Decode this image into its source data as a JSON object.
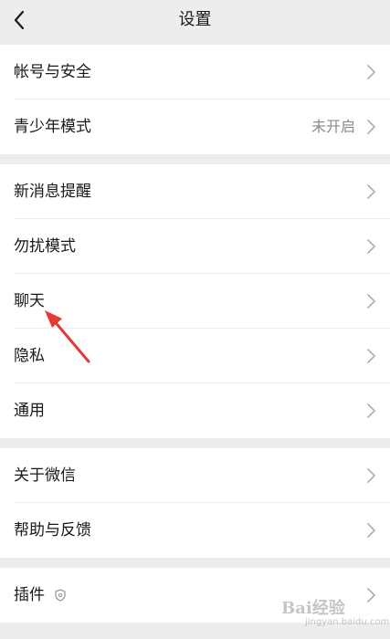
{
  "header": {
    "title": "设置",
    "back_icon": "chevron-left-icon"
  },
  "group1": {
    "items": [
      {
        "label": "帐号与安全",
        "value": ""
      },
      {
        "label": "青少年模式",
        "value": "未开启"
      }
    ]
  },
  "group2": {
    "items": [
      {
        "label": "新消息提醒"
      },
      {
        "label": "勿扰模式"
      },
      {
        "label": "聊天"
      },
      {
        "label": "隐私"
      },
      {
        "label": "通用"
      }
    ]
  },
  "group3": {
    "items": [
      {
        "label": "关于微信"
      },
      {
        "label": "帮助与反馈"
      }
    ]
  },
  "group4": {
    "items": [
      {
        "label": "插件",
        "icon": "plugin-shield-icon"
      }
    ]
  },
  "annotation": {
    "arrow_color": "#e53935"
  },
  "watermark": {
    "logo": "Bai经验",
    "sub": "jingyan.baidu.com"
  },
  "colors": {
    "background": "#ededed",
    "row_background": "#ffffff",
    "text": "#191919",
    "secondary_text": "#8a8a8a",
    "chevron": "#b2b2b2"
  }
}
